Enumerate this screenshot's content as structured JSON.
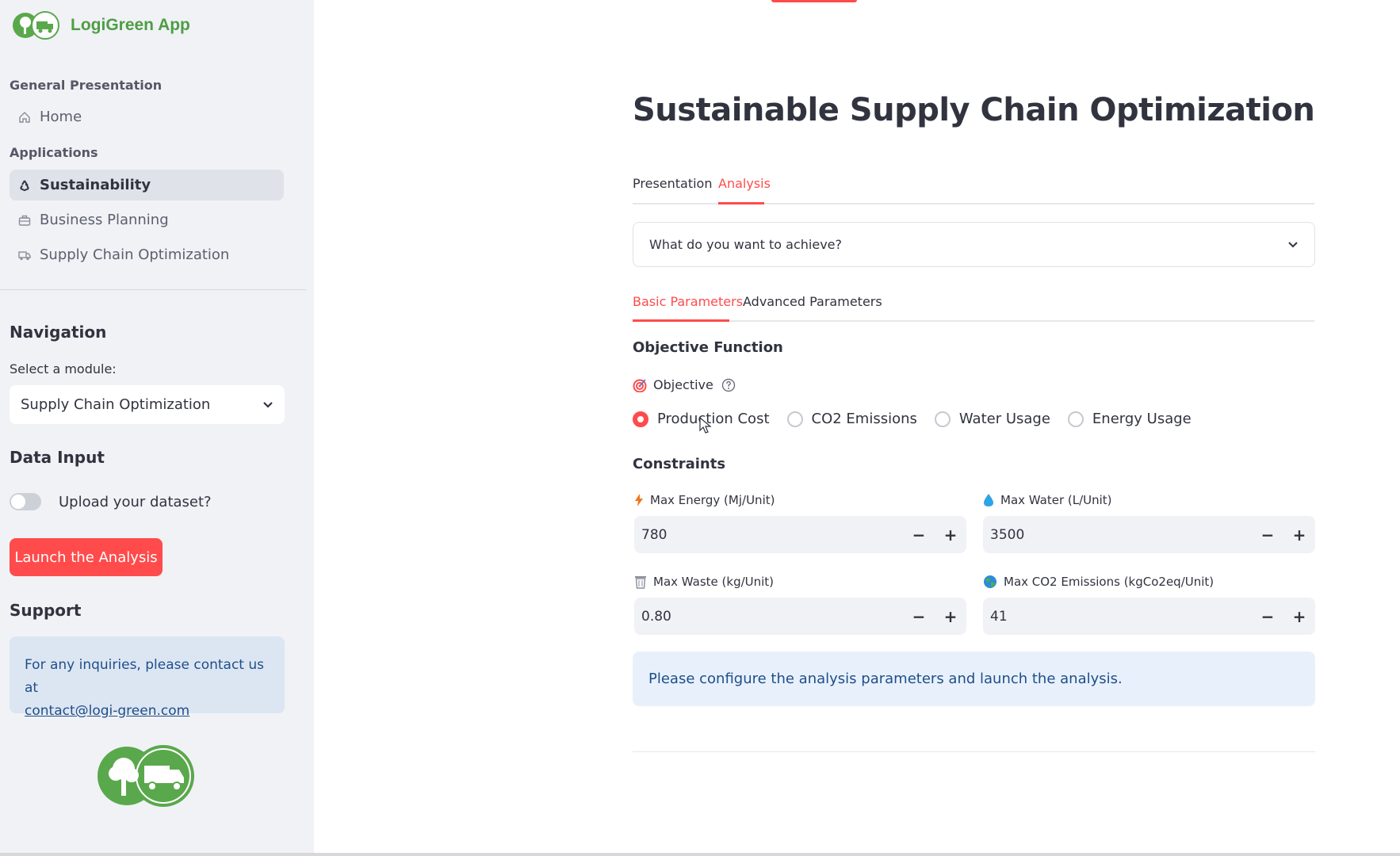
{
  "colors": {
    "accent": "#ff4b4b",
    "brand": "#4e9d44",
    "info_bg": "#e8f1fb",
    "info_text": "#1f4e8a"
  },
  "sidebar": {
    "app_name": "LogiGreen App",
    "section_general": "General Presentation",
    "home": "Home",
    "section_apps": "Applications",
    "items": [
      {
        "label": "Sustainability",
        "icon": "recycle-icon",
        "active": true
      },
      {
        "label": "Business Planning",
        "icon": "briefcase-icon",
        "active": false
      },
      {
        "label": "Supply Chain Optimization",
        "icon": "truck-icon",
        "active": false
      }
    ],
    "navigation_title": "Navigation",
    "select_label": "Select a module:",
    "select_value": "Supply Chain Optimization",
    "data_input_title": "Data Input",
    "upload_toggle_label": "Upload your dataset?",
    "launch_button": "Launch the Analysis",
    "support_title": "Support",
    "support_text": "For any inquiries, please contact us at",
    "support_email": "contact@logi-green.com"
  },
  "main": {
    "title": "Sustainable Supply Chain Optimization",
    "tabs": [
      "Presentation",
      "Analysis"
    ],
    "active_tab": "Analysis",
    "expander": "What do you want to achieve?",
    "param_tabs": [
      "Basic Parameters",
      "Advanced Parameters"
    ],
    "objective_function_title": "Objective Function",
    "objective_label": "Objective",
    "objective_options": [
      "Production Cost",
      "CO2 Emissions",
      "Water Usage",
      "Energy Usage"
    ],
    "objective_selected": "Production Cost",
    "constraints_title": "Constraints",
    "constraints": [
      {
        "label": "Max Energy (Mj/Unit)",
        "value": "780",
        "icon": "lightning-icon"
      },
      {
        "label": "Max Water (L/Unit)",
        "value": "3500",
        "icon": "water-drop-icon"
      },
      {
        "label": "Max Waste (kg/Unit)",
        "value": "0.80",
        "icon": "trash-icon"
      },
      {
        "label": "Max CO2 Emissions (kgCo2eq/Unit)",
        "value": "41",
        "icon": "globe-icon"
      }
    ],
    "info_message": "Please configure the analysis parameters and launch the analysis."
  }
}
